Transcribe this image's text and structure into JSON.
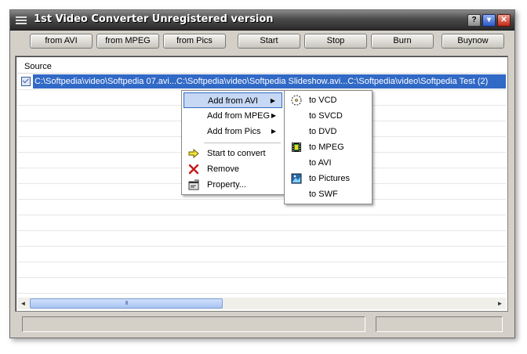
{
  "window": {
    "title": "1st Video Converter Unregistered version",
    "help_button": "?",
    "minimize_button": "▾",
    "close_button": "✕"
  },
  "toolbar": {
    "buttons": [
      "from AVI",
      "from MPEG",
      "from Pics",
      "Start",
      "Stop",
      "Burn",
      "Buynow"
    ]
  },
  "list": {
    "column_header": "Source",
    "selected_row": "C:\\Softpedia\\video\\Softpedia 07.avi...C:\\Softpedia\\video\\Softpedia Slideshow.avi...C:\\Softpedia\\video\\Softpedia Test (2)",
    "scroll_grip": "III",
    "scroll_left": "◄",
    "scroll_right": "►"
  },
  "context_menu": {
    "items": [
      {
        "label": "Add from AVI",
        "submenu": true
      },
      {
        "label": "Add from MPEG",
        "submenu": true
      },
      {
        "label": "Add from Pics",
        "submenu": true
      },
      {
        "label": "Start to convert"
      },
      {
        "label": "Remove"
      },
      {
        "label": "Property..."
      }
    ],
    "submenu_arrow": "▶"
  },
  "submenu": {
    "items": [
      "to VCD",
      "to SVCD",
      "to DVD",
      "to MPEG",
      "to AVI",
      "to Pictures",
      "to SWF"
    ]
  },
  "colors": {
    "selection": "#3169c6",
    "menu_highlight": "#c6d8f4",
    "titlebar": "#2a2a2a"
  }
}
